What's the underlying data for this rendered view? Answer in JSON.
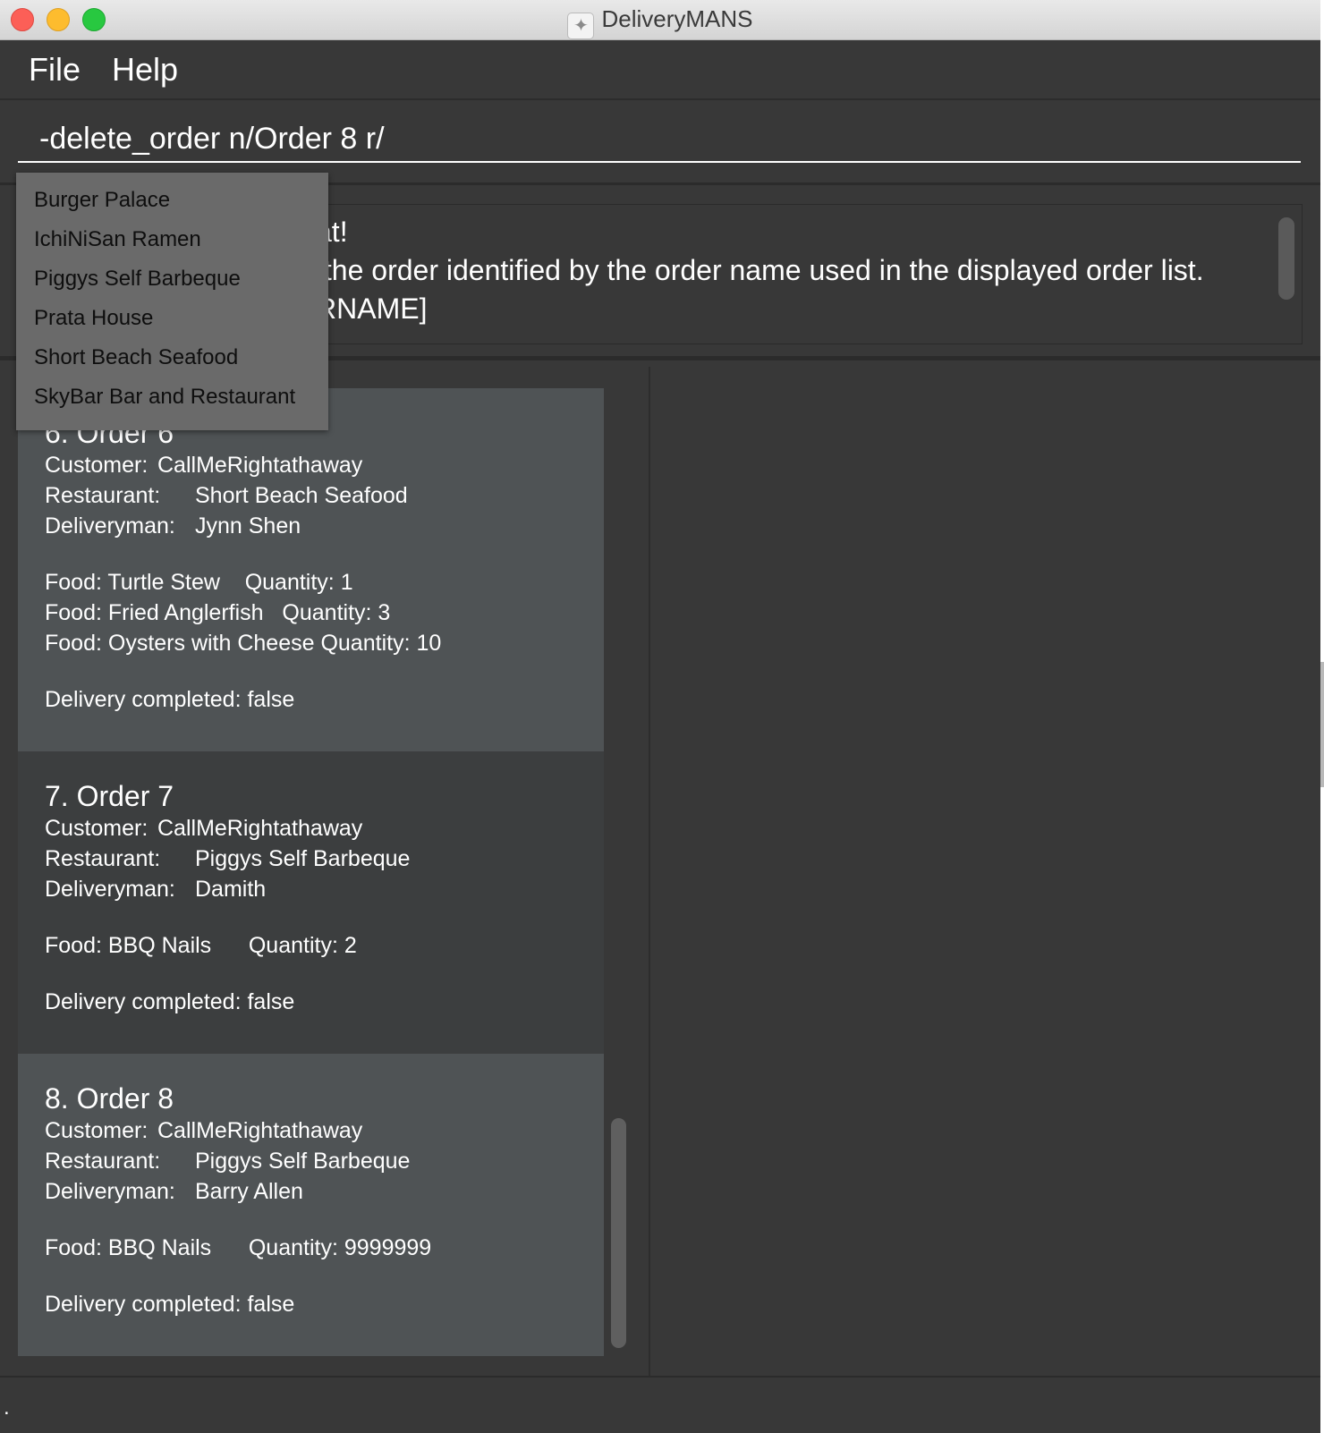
{
  "window": {
    "title": "DeliveryMANS",
    "app_icon": "app-logo-icon"
  },
  "menu": {
    "items": [
      "File",
      "Help"
    ]
  },
  "command_box": {
    "value": "-delete_order n/Order 8 r/"
  },
  "result_display": {
    "lines": [
      "at!",
      " the order identified by the order name used in the displayed order list.",
      "RNAME]"
    ]
  },
  "autocomplete": {
    "options": [
      "Burger Palace",
      "IchiNiSan Ramen",
      "Piggys Self Barbeque",
      "Prata House",
      "Short Beach Seafood",
      "SkyBar Bar and Restaurant"
    ]
  },
  "labels": {
    "customer": "Customer:",
    "restaurant": "Restaurant:",
    "deliveryman": "Deliveryman:"
  },
  "orders": [
    {
      "title": "6.  Order 6",
      "customer": "CallMeRightathaway",
      "restaurant": "Short Beach Seafood",
      "deliveryman": "Jynn Shen",
      "foods": [
        "Food: Turtle Stew    Quantity: 1",
        "Food: Fried Anglerfish   Quantity: 3",
        "Food: Oysters with Cheese Quantity: 10"
      ],
      "status": "Delivery completed: false"
    },
    {
      "title": "7.  Order 7",
      "customer": "CallMeRightathaway",
      "restaurant": "Piggys Self Barbeque",
      "deliveryman": "Damith",
      "foods": [
        "Food: BBQ Nails      Quantity: 2"
      ],
      "status": "Delivery completed: false"
    },
    {
      "title": "8.  Order 8",
      "customer": "CallMeRightathaway",
      "restaurant": "Piggys Self Barbeque",
      "deliveryman": "Barry Allen",
      "foods": [
        "Food: BBQ Nails      Quantity: 9999999"
      ],
      "status": "Delivery completed: false"
    }
  ],
  "status_bar": {
    "text": "."
  },
  "colors": {
    "background": "#383838",
    "card_selected": "#4f5355",
    "card_default": "#3c3e3f",
    "dropdown": "#6a6a6a",
    "text": "#ffffff"
  }
}
